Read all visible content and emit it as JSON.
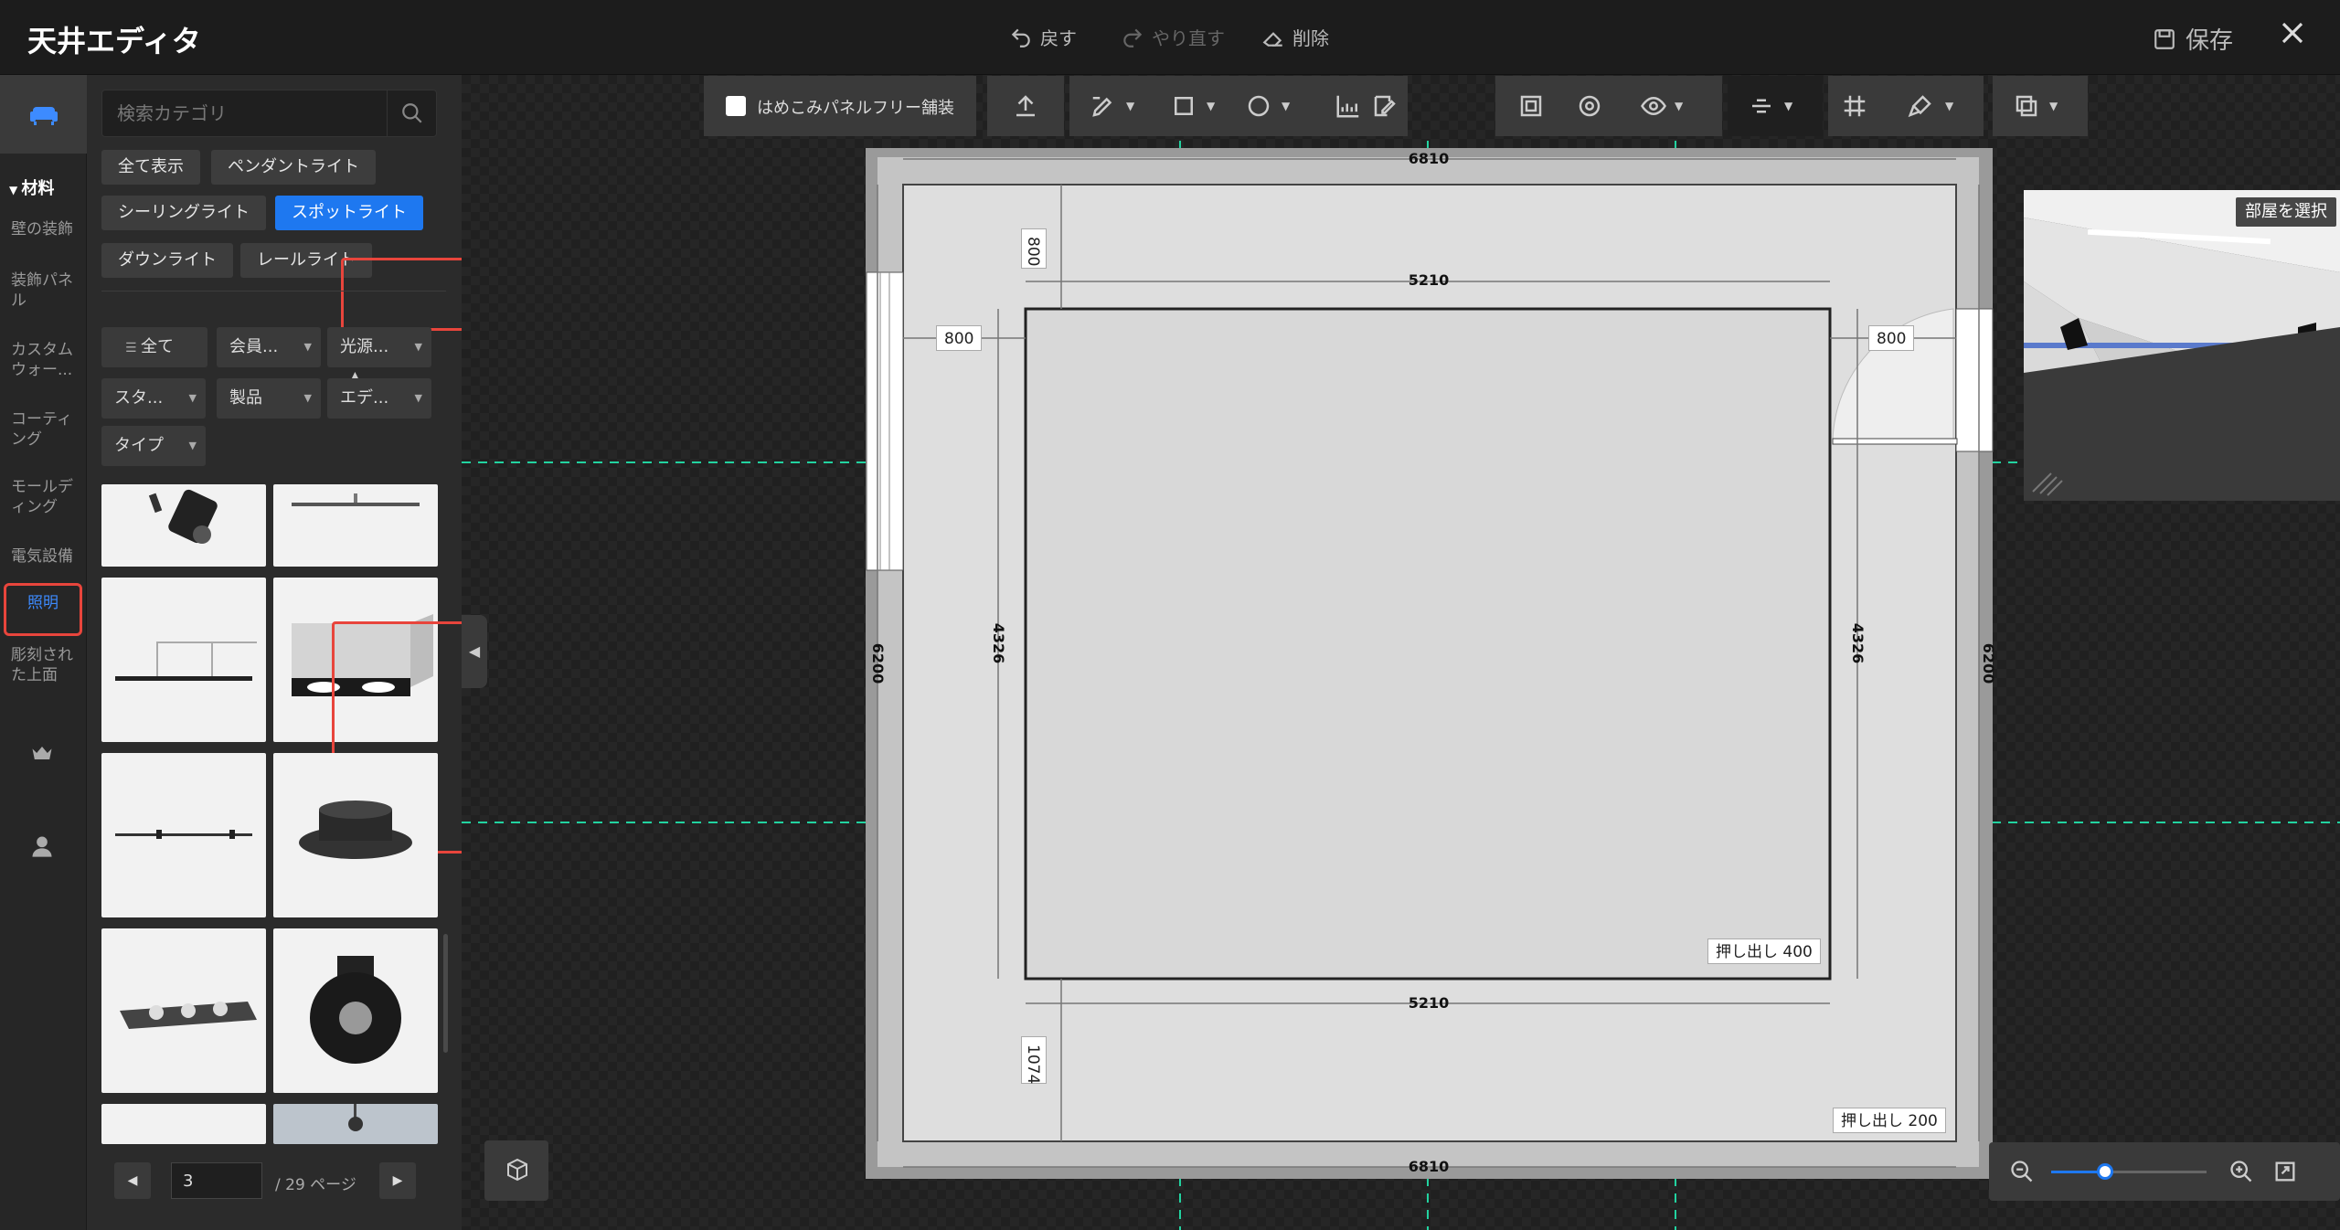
{
  "header": {
    "title": "天井エディタ",
    "undo_label": "戻す",
    "redo_label": "やり直す",
    "delete_label": "削除",
    "save_label": "保存"
  },
  "rail": {
    "section_label": "材料",
    "items": [
      {
        "label": "壁の装飾"
      },
      {
        "label": "装飾パネル"
      },
      {
        "label": "カスタムウォー..."
      },
      {
        "label": "コーティング"
      },
      {
        "label": "モールディング"
      },
      {
        "label": "電気設備"
      },
      {
        "label": "照明"
      },
      {
        "label": "彫刻された上面"
      }
    ]
  },
  "category_panel": {
    "search_placeholder": "検索カテゴリ",
    "chips": [
      "全て表示",
      "ペンダントライト",
      "シーリングライト",
      "スポットライト",
      "ダウンライト",
      "レールライト"
    ],
    "selected_chip": "スポットライト",
    "filters": [
      "全て",
      "会員...",
      "光源...",
      "スタ...",
      "製品",
      "エデ...",
      "タイプ"
    ],
    "page_current": "3",
    "page_total_label": "/ 29 ページ"
  },
  "toolbar": {
    "panel_free_label": "はめこみパネルフリー舗装"
  },
  "plan": {
    "dim_top": "6810",
    "dim_bottom": "6810",
    "dim_inner_top": "5210",
    "dim_inner_bottom": "5210",
    "dim_left": "6200",
    "dim_right": "6200",
    "dim_inner_left": "4326",
    "dim_inner_right": "4326",
    "offset_top": "800",
    "offset_left": "800",
    "offset_right": "800",
    "offset_bottom": "1074",
    "extrude_inner": "押し出し  400",
    "extrude_outer": "押し出し  200"
  },
  "preview": {
    "select_room_label": "部屋を選択"
  },
  "colors": {
    "accent": "#1e78f0",
    "highlight": "#e8453c",
    "guide": "#22d3a0"
  }
}
